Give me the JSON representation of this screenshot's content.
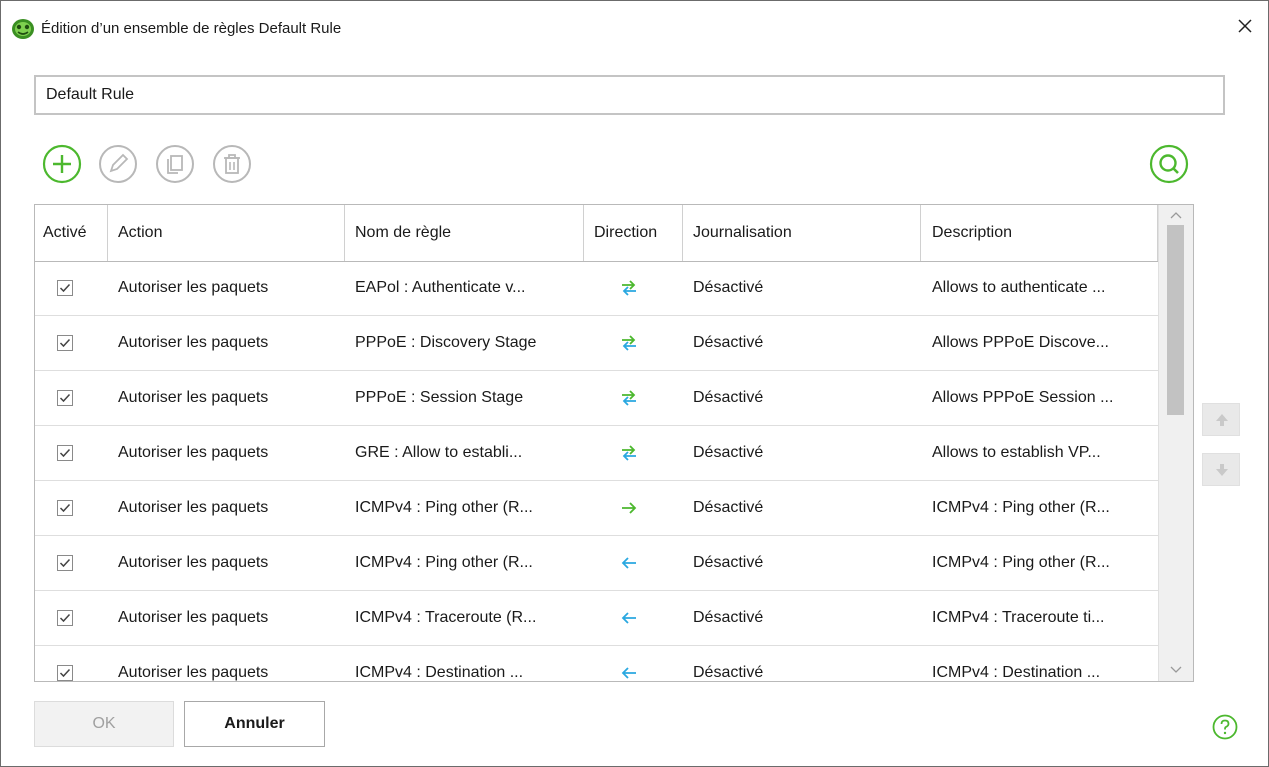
{
  "window": {
    "title": "Édition d’un ensemble de règles Default Rule"
  },
  "rule_set_name": {
    "value": "Default Rule"
  },
  "toolbar": {
    "add": "add-icon",
    "edit": "pencil-icon",
    "copy": "copy-icon",
    "delete": "trash-icon",
    "search": "search-icon"
  },
  "table": {
    "columns": [
      "Activé",
      "Action",
      "Nom de règle",
      "Direction",
      "Journalisation",
      "Description"
    ],
    "rows": [
      {
        "enabled": true,
        "action": "Autoriser les paquets",
        "name": "EAPol : Authenticate v...",
        "direction": "both",
        "logging": "Désactivé",
        "description": "Allows to authenticate ..."
      },
      {
        "enabled": true,
        "action": "Autoriser les paquets",
        "name": "PPPoE : Discovery Stage",
        "direction": "both",
        "logging": "Désactivé",
        "description": "Allows PPPoE Discove..."
      },
      {
        "enabled": true,
        "action": "Autoriser les paquets",
        "name": "PPPoE : Session Stage",
        "direction": "both",
        "logging": "Désactivé",
        "description": "Allows PPPoE Session ..."
      },
      {
        "enabled": true,
        "action": "Autoriser les paquets",
        "name": "GRE : Allow to establi...",
        "direction": "both",
        "logging": "Désactivé",
        "description": "Allows to establish VP..."
      },
      {
        "enabled": true,
        "action": "Autoriser les paquets",
        "name": "ICMPv4 : Ping other (R...",
        "direction": "out",
        "logging": "Désactivé",
        "description": "ICMPv4 : Ping other (R..."
      },
      {
        "enabled": true,
        "action": "Autoriser les paquets",
        "name": "ICMPv4 : Ping other (R...",
        "direction": "in",
        "logging": "Désactivé",
        "description": "ICMPv4 : Ping other (R..."
      },
      {
        "enabled": true,
        "action": "Autoriser les paquets",
        "name": "ICMPv4 : Traceroute (R...",
        "direction": "in",
        "logging": "Désactivé",
        "description": "ICMPv4 : Traceroute ti..."
      },
      {
        "enabled": true,
        "action": "Autoriser les paquets",
        "name": "ICMPv4 : Destination ...",
        "direction": "in",
        "logging": "Désactivé",
        "description": "ICMPv4 : Destination ..."
      }
    ]
  },
  "buttons": {
    "ok": "OK",
    "cancel": "Annuler"
  },
  "colors": {
    "accent_green": "#4cb82e",
    "direction_blue": "#2aa8e0",
    "disabled_gray": "#b8b8b8"
  }
}
